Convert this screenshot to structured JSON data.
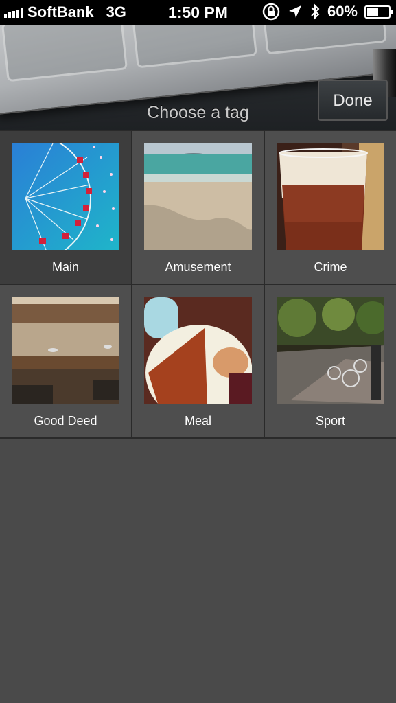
{
  "status_bar": {
    "carrier": "SoftBank",
    "network": "3G",
    "time": "1:50 PM",
    "battery": "60%",
    "battery_level": 0.6,
    "icons": [
      "signal-icon",
      "rotation-lock-icon",
      "location-icon",
      "bluetooth-icon",
      "battery-icon"
    ]
  },
  "header": {
    "title": "Choose a tag",
    "done_label": "Done"
  },
  "tags": [
    {
      "label": "Main",
      "selected": true,
      "image": "ferris-wheel-photo"
    },
    {
      "label": "Amusement",
      "selected": false,
      "image": "beach-photo"
    },
    {
      "label": "Crime",
      "selected": false,
      "image": "beer-glass-photo"
    },
    {
      "label": "Good Deed",
      "selected": false,
      "image": "canal-photo"
    },
    {
      "label": "Meal",
      "selected": false,
      "image": "breakfast-plate-photo"
    },
    {
      "label": "Sport",
      "selected": false,
      "image": "bicycles-park-photo"
    }
  ]
}
